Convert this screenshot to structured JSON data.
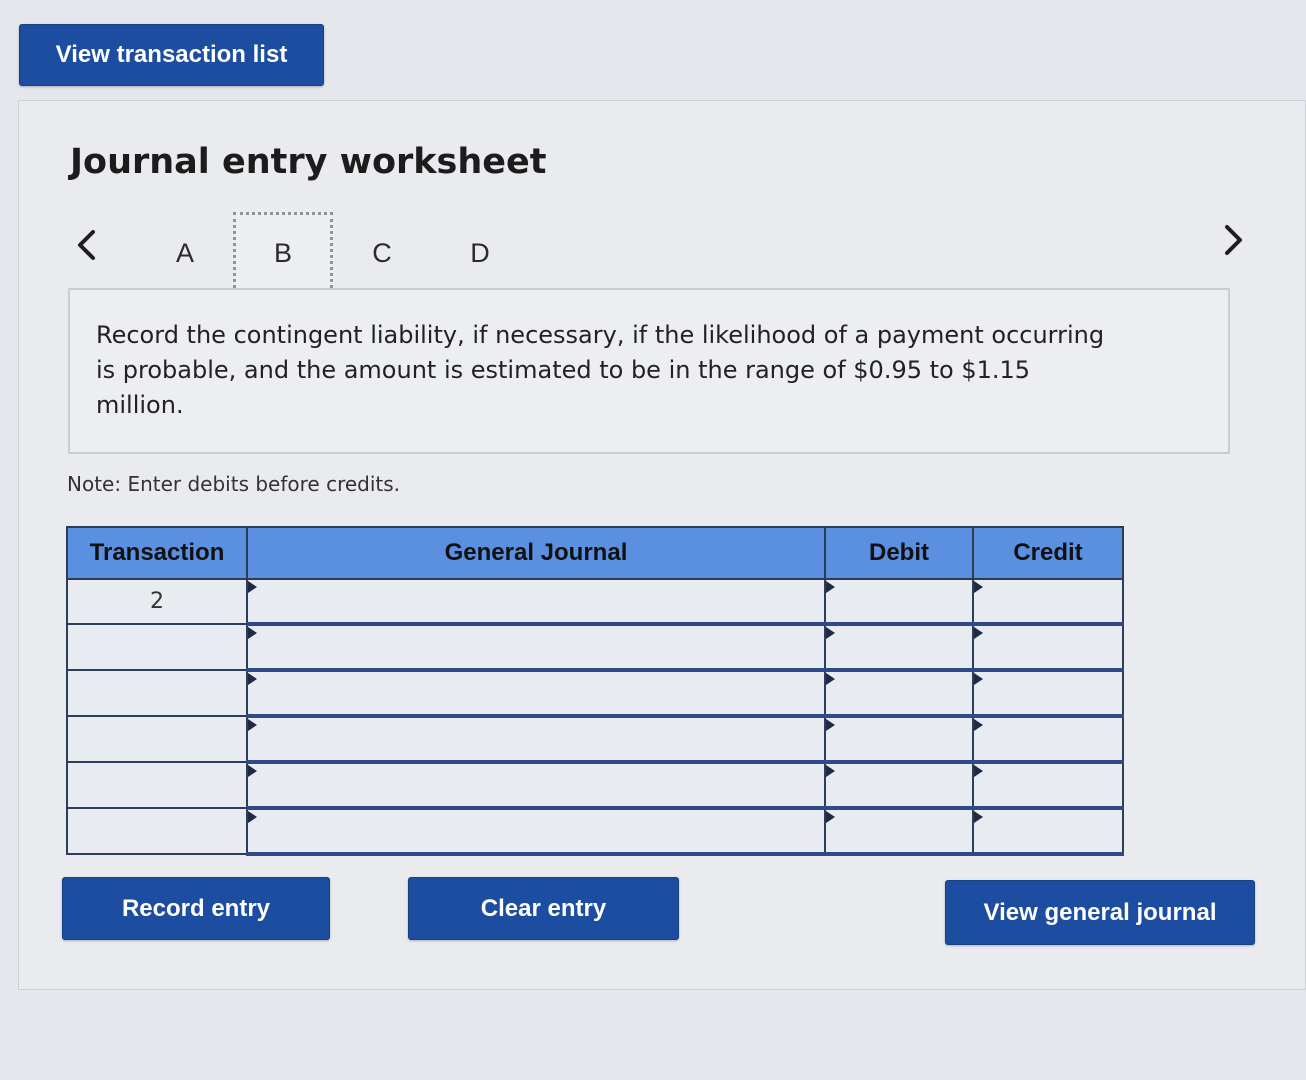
{
  "top_button": {
    "label": "View transaction list"
  },
  "worksheet": {
    "title": "Journal entry worksheet",
    "tabs": [
      "A",
      "B",
      "C",
      "D"
    ],
    "active_tab": "B",
    "instruction": "Record the contingent liability, if necessary, if the likelihood of a payment occurring is probable, and the amount is estimated to be in the range of $0.95 to $1.15 million.",
    "note": "Note: Enter debits before credits."
  },
  "table": {
    "headers": [
      "Transaction",
      "General Journal",
      "Debit",
      "Credit"
    ],
    "rows": [
      {
        "transaction": "2",
        "journal": "",
        "debit": "",
        "credit": ""
      },
      {
        "transaction": "",
        "journal": "",
        "debit": "",
        "credit": ""
      },
      {
        "transaction": "",
        "journal": "",
        "debit": "",
        "credit": ""
      },
      {
        "transaction": "",
        "journal": "",
        "debit": "",
        "credit": ""
      },
      {
        "transaction": "",
        "journal": "",
        "debit": "",
        "credit": ""
      },
      {
        "transaction": "",
        "journal": "",
        "debit": "",
        "credit": ""
      }
    ]
  },
  "buttons": {
    "record": "Record entry",
    "clear": "Clear entry",
    "view_journal": "View general journal"
  },
  "colors": {
    "button_blue": "#1d4da1",
    "header_blue": "#5b8fe0"
  }
}
